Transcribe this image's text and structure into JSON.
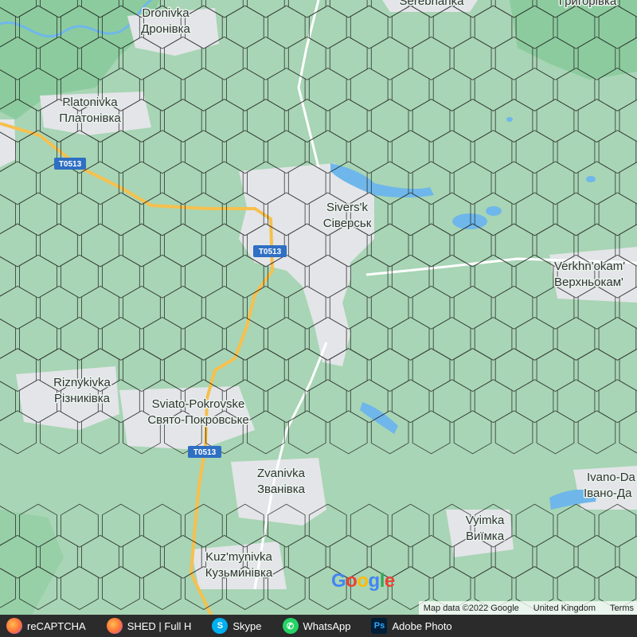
{
  "map": {
    "places": [
      {
        "id": "dronivka",
        "lines": [
          "Dronivka",
          "Дронівка"
        ]
      },
      {
        "id": "serebrianka",
        "lines": [
          "Serebrianka"
        ]
      },
      {
        "id": "hryhorivka",
        "lines": [
          "Григорівка"
        ]
      },
      {
        "id": "platonivka",
        "lines": [
          "Platonivka",
          "Платонівка"
        ]
      },
      {
        "id": "siversk",
        "lines": [
          "Sivers'k",
          "Сіверськ"
        ]
      },
      {
        "id": "verkhnokamianske",
        "lines": [
          "Verkhn'okam'",
          "Верхньокам'"
        ]
      },
      {
        "id": "riznykivka",
        "lines": [
          "Riznykivka",
          "Різниківка"
        ]
      },
      {
        "id": "sviato-pokrovske",
        "lines": [
          "Sviato-Pokrovske",
          "Свято-Покровське"
        ]
      },
      {
        "id": "zvanivka",
        "lines": [
          "Zvanivka",
          "Званівка"
        ]
      },
      {
        "id": "ivano-darivka",
        "lines": [
          "Ivano-Da",
          "Івано-Да"
        ]
      },
      {
        "id": "vyimka",
        "lines": [
          "Vyimka",
          "Виїмка"
        ]
      },
      {
        "id": "kuzmynivka",
        "lines": [
          "Kuz'mynivka",
          "Кузьминівка"
        ]
      }
    ],
    "road_labels": [
      "T0513",
      "T0513",
      "T0513"
    ],
    "google_logo": "Google",
    "attribution": {
      "map_data": "Map data ©2022 Google",
      "region": "United Kingdom",
      "terms": "Terms"
    }
  },
  "taskbar": {
    "items": [
      {
        "label": "reCAPTCHA",
        "icon": "firefox-icon"
      },
      {
        "label": "SHED | Full H",
        "icon": "firefox-icon"
      },
      {
        "label": "Skype",
        "icon": "skype-icon"
      },
      {
        "label": "WhatsApp",
        "icon": "whatsapp-icon"
      },
      {
        "label": "Adobe Photo",
        "icon": "photoshop-icon",
        "icon_text": "Ps"
      }
    ]
  },
  "colors": {
    "land": "#a8d5b5",
    "forest": "#8ccb9e",
    "urban": "#e3e5e8",
    "water": "#6fb7ea",
    "highway": "#f6c04e",
    "road": "#ffffff",
    "road_badge": "#2f6fc4",
    "taskbar": "#2b2b2b"
  }
}
